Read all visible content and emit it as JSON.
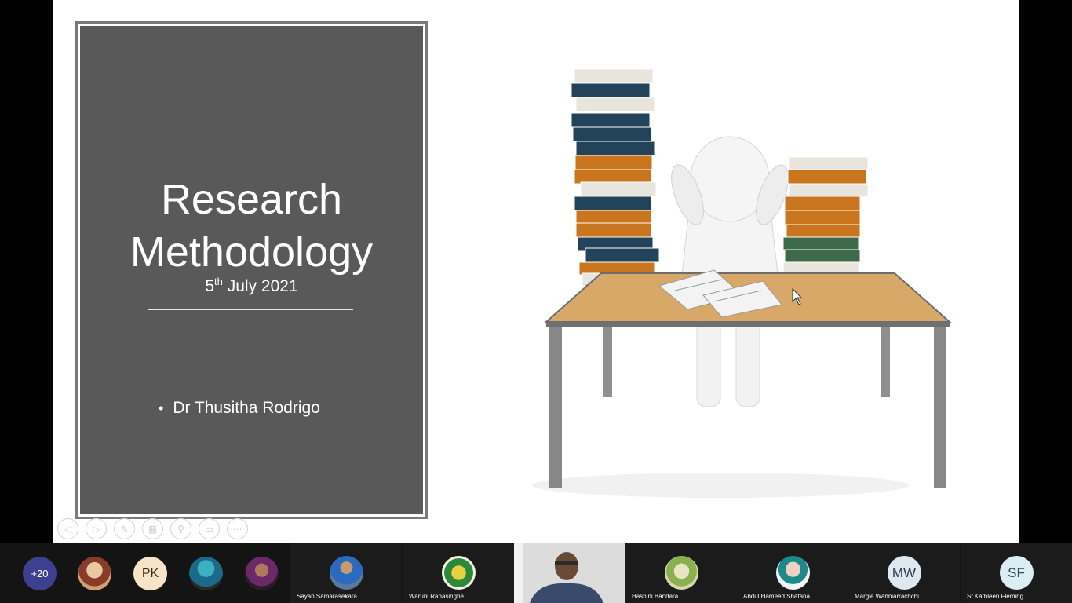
{
  "slide": {
    "title_line1": "Research",
    "title_line2": "Methodology",
    "date_day": "5",
    "date_suffix": "th",
    "date_rest": " July 2021",
    "presenter": "Dr Thusitha Rodrigo"
  },
  "strip": {
    "overflow_count": "+20",
    "pk_initials": "PK",
    "participants": [
      {
        "name": "Sayan Samarasekara"
      },
      {
        "name": "Waruni Ranasinghe"
      },
      {
        "name": "Hashini Bandara"
      },
      {
        "name": "Abdul Hameed Shafana"
      },
      {
        "name": "Margie Wanniarrachchi",
        "initials": "MW"
      },
      {
        "name": "Sr.Kathleen Fleming",
        "initials": "SF"
      }
    ]
  },
  "colors": {
    "title_panel": "#595959",
    "strip_bg": "#141414",
    "overflow_badge": "#3f3f8f",
    "pk_badge": "#f6e3c8",
    "mw_badge": "#dde8f0",
    "sf_badge": "#dbeef3"
  },
  "icons": [
    "prev-icon",
    "next-icon",
    "pen-icon",
    "slides-icon",
    "zoom-icon",
    "subtitles-icon",
    "more-icon"
  ]
}
